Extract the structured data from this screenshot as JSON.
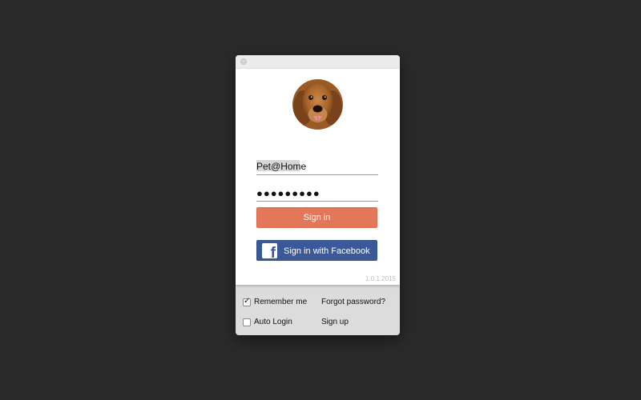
{
  "login": {
    "username": "Pet@Home",
    "password_mask": "●●●●●●●●●",
    "signin_label": "Sign in",
    "facebook_label": "Sign in with Facebook",
    "facebook_glyph": "f",
    "version": "1.0.1.2015"
  },
  "options": {
    "remember_label": "Remember me",
    "remember_checked": true,
    "autologin_label": "Auto Login",
    "autologin_checked": false,
    "forgot_label": "Forgot password?",
    "signup_label": "Sign up",
    "check_glyph": "✓"
  },
  "colors": {
    "signin_button": "#e3775a",
    "facebook_button": "#3b5998",
    "background": "#2a2a2a"
  },
  "icons": {
    "avatar": "dog-avatar",
    "facebook": "facebook-icon",
    "close": "close-dot-icon"
  }
}
